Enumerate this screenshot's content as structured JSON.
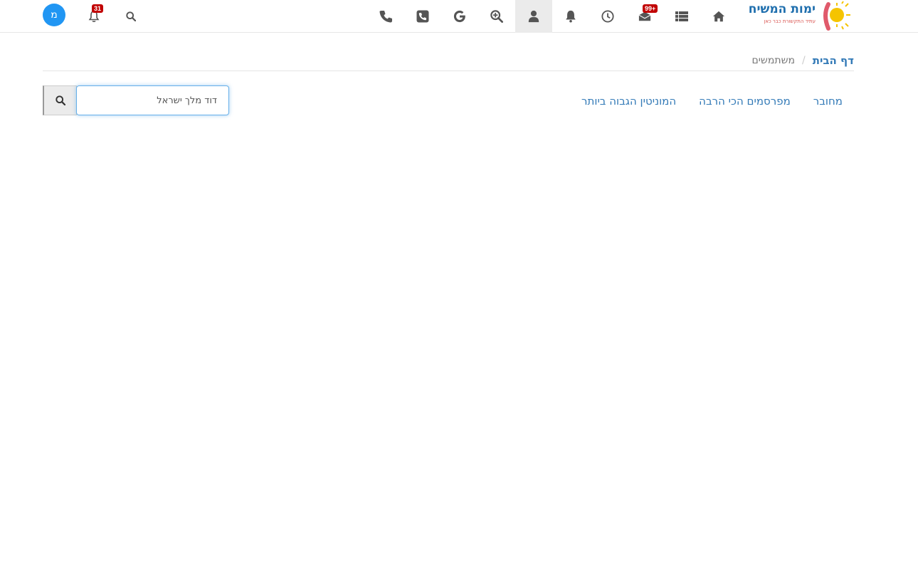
{
  "header": {
    "logo_text": "ימות המשיח",
    "logo_subtext": "עתיד התקשורת כבר כאן",
    "messages_badge": "99+",
    "notifications_badge": "31",
    "avatar_letter": "מ",
    "active_icon": "user-icon",
    "icons": [
      "home-icon",
      "list-icon",
      "messages-icon",
      "clock-icon",
      "bell-icon",
      "user-icon",
      "search-plus-icon",
      "google-icon",
      "phone-square-icon",
      "phone-icon"
    ]
  },
  "breadcrumb": {
    "home": "דף הבית",
    "separator": "/",
    "current": "משתמשים"
  },
  "tabs": [
    {
      "label": "מחובר"
    },
    {
      "label": "מפרסמים הכי הרבה"
    },
    {
      "label": "המוניטין הגבוה ביותר"
    }
  ],
  "search": {
    "value": "דוד מלך ישראל"
  },
  "colors": {
    "link": "#337ab7",
    "badge": "#c10000",
    "avatar": "#2196f3"
  }
}
